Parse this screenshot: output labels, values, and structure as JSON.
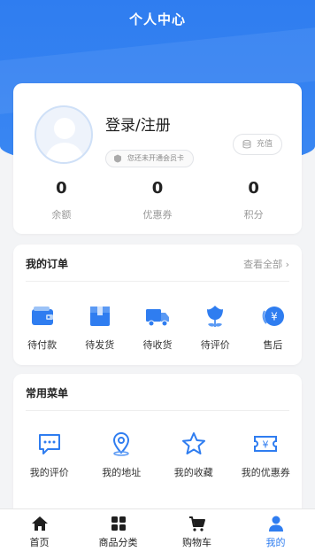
{
  "header": {
    "title": "个人中心"
  },
  "profile": {
    "login_label": "登录/注册",
    "member_status": "您还未开通会员卡",
    "recharge_label": "充值",
    "stats": [
      {
        "value": "0",
        "label": "余额"
      },
      {
        "value": "0",
        "label": "优惠券"
      },
      {
        "value": "0",
        "label": "积分"
      }
    ]
  },
  "orders": {
    "title": "我的订单",
    "view_all": "查看全部",
    "items": [
      {
        "label": "待付款",
        "icon": "wallet-icon"
      },
      {
        "label": "待发货",
        "icon": "package-icon"
      },
      {
        "label": "待收货",
        "icon": "truck-icon"
      },
      {
        "label": "待评价",
        "icon": "flower-icon"
      },
      {
        "label": "售后",
        "icon": "yuan-refund-icon"
      }
    ]
  },
  "menu": {
    "title": "常用菜单",
    "items": [
      {
        "label": "我的评价",
        "icon": "comment-icon"
      },
      {
        "label": "我的地址",
        "icon": "location-icon"
      },
      {
        "label": "我的收藏",
        "icon": "star-icon"
      },
      {
        "label": "我的优惠券",
        "icon": "coupon-icon"
      }
    ]
  },
  "tabbar": {
    "items": [
      {
        "label": "首页",
        "icon": "home-icon"
      },
      {
        "label": "商品分类",
        "icon": "category-icon"
      },
      {
        "label": "购物车",
        "icon": "cart-icon"
      },
      {
        "label": "我的",
        "icon": "user-icon"
      }
    ],
    "active_index": 3
  },
  "colors": {
    "primary": "#2f7df0",
    "background": "#f3f4f6"
  }
}
